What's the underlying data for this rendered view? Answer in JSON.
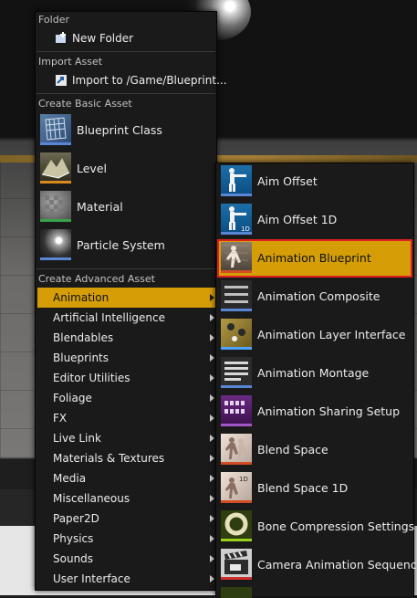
{
  "main_menu": {
    "folder_header": "Folder",
    "new_folder": "New Folder",
    "import_header": "Import Asset",
    "import_to": "Import to /Game/Blueprint...",
    "basic_header": "Create Basic Asset",
    "basic_items": [
      "Blueprint Class",
      "Level",
      "Material",
      "Particle System"
    ],
    "advanced_header": "Create Advanced Asset",
    "categories": [
      "Animation",
      "Artificial Intelligence",
      "Blendables",
      "Blueprints",
      "Editor Utilities",
      "Foliage",
      "FX",
      "Live Link",
      "Materials & Textures",
      "Media",
      "Miscellaneous",
      "Paper2D",
      "Physics",
      "Sounds",
      "User Interface"
    ],
    "active_category": "Animation"
  },
  "animation_submenu": {
    "items": [
      "Aim Offset",
      "Aim Offset 1D",
      "Animation Blueprint",
      "Animation Composite",
      "Animation Layer Interface",
      "Animation Montage",
      "Animation Sharing Setup",
      "Blend Space",
      "Blend Space 1D",
      "Bone Compression Settings",
      "Camera Animation Sequence"
    ],
    "highlighted": "Animation Blueprint",
    "icon_labels": {
      "aim_offset_1d": "1D",
      "blend_space_1d": "1D"
    }
  },
  "colors": {
    "accent": "#d59e06",
    "highlight_outline": "#e02020",
    "menu_bg": "#1a1a1a",
    "text": "#ececec",
    "header_text": "#c2c2c2"
  }
}
